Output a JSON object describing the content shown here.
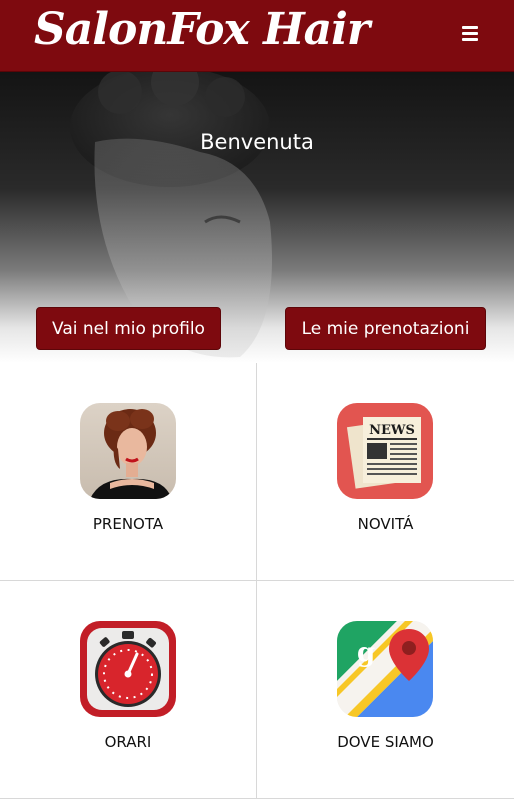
{
  "header": {
    "logo_text": "SalonFox Hair",
    "menu_icon": "hamburger-menu-icon"
  },
  "hero": {
    "title": "Benvenuta",
    "profile_button": "Vai nel mio profilo",
    "bookings_button": "Le mie prenotazioni"
  },
  "tiles": [
    {
      "label": "PRENOTA",
      "icon": "woman-portrait-icon"
    },
    {
      "label": "NOVITÁ",
      "icon": "newspaper-icon"
    },
    {
      "label": "ORARI",
      "icon": "stopwatch-icon"
    },
    {
      "label": "DOVE SIAMO",
      "icon": "maps-icon"
    }
  ],
  "colors": {
    "brand": "#7e0a0f",
    "divider": "#d8d8d8"
  },
  "news_icon_text": "NEWS"
}
